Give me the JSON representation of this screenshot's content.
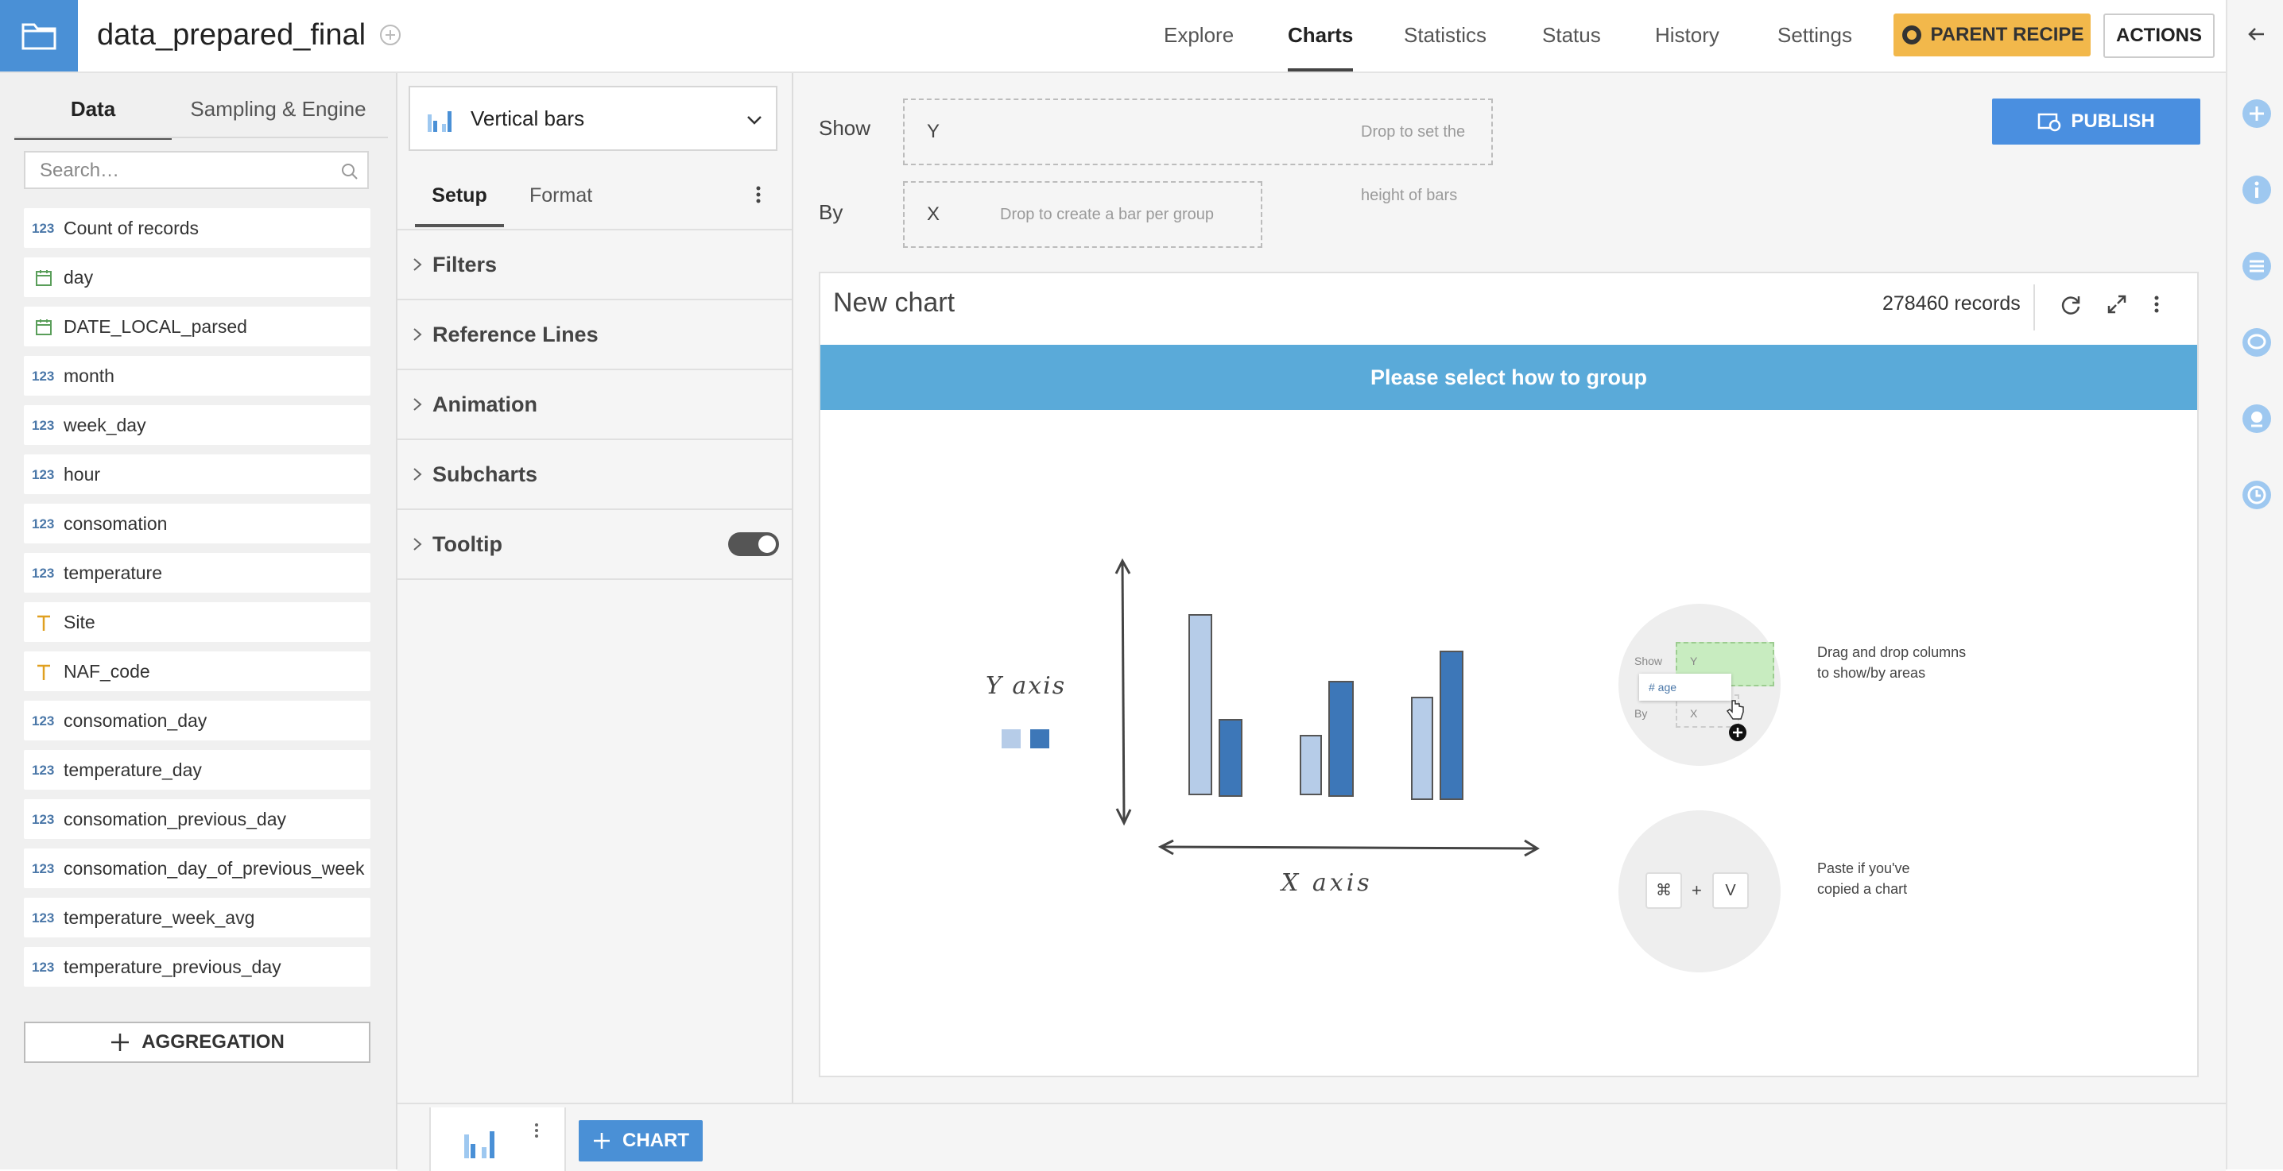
{
  "header": {
    "dataset_name": "data_prepared_final",
    "nav": [
      "Explore",
      "Charts",
      "Statistics",
      "Status",
      "History",
      "Settings"
    ],
    "active_nav": "Charts",
    "parent_recipe_label": "PARENT RECIPE",
    "actions_label": "ACTIONS"
  },
  "left_panel": {
    "tabs": [
      "Data",
      "Sampling & Engine"
    ],
    "search_placeholder": "Search…",
    "columns": [
      {
        "type": "123",
        "name": "Count of records"
      },
      {
        "type": "date",
        "name": "day"
      },
      {
        "type": "date",
        "name": "DATE_LOCAL_parsed"
      },
      {
        "type": "123",
        "name": "month"
      },
      {
        "type": "123",
        "name": "week_day"
      },
      {
        "type": "123",
        "name": "hour"
      },
      {
        "type": "123",
        "name": "consomation"
      },
      {
        "type": "123",
        "name": "temperature"
      },
      {
        "type": "text",
        "name": "Site"
      },
      {
        "type": "text",
        "name": "NAF_code"
      },
      {
        "type": "123",
        "name": "consomation_day"
      },
      {
        "type": "123",
        "name": "temperature_day"
      },
      {
        "type": "123",
        "name": "consomation_previous_day"
      },
      {
        "type": "123",
        "name": "consomation_day_of_previous_week"
      },
      {
        "type": "123",
        "name": "temperature_week_avg"
      },
      {
        "type": "123",
        "name": "temperature_previous_day"
      }
    ],
    "aggregation_label": "AGGREGATION"
  },
  "config_panel": {
    "chart_type": "Vertical bars",
    "subtabs": [
      "Setup",
      "Format"
    ],
    "sections": [
      "Filters",
      "Reference Lines",
      "Animation",
      "Subcharts",
      "Tooltip"
    ],
    "tooltip_enabled": true
  },
  "main": {
    "show_label": "Show",
    "by_label": "By",
    "y_letter": "Y",
    "y_hint": "Drop to set the height of bars",
    "x_letter": "X",
    "x_hint": "Drop to create a bar per group",
    "publish_label": "PUBLISH",
    "chart_title": "New chart",
    "records": "278460 records",
    "banner": "Please select how to group",
    "illus_y_axis": "Y axis",
    "illus_x_axis": "X axis",
    "dnd_help": "Drag and drop columns\nto show/by areas",
    "paste_help": "Paste if you've\ncopied a chart",
    "mini_show": "Show",
    "mini_by": "By",
    "mini_y": "Y",
    "mini_x": "X",
    "mini_age": "# age",
    "key_cmd": "⌘",
    "key_plus": "+",
    "key_v": "V"
  },
  "bottom_bar": {
    "add_chart_label": "CHART"
  },
  "colors": {
    "accent_blue": "#4a90d6",
    "banner_blue": "#5aaad9",
    "recipe_yellow": "#f2b84b"
  }
}
